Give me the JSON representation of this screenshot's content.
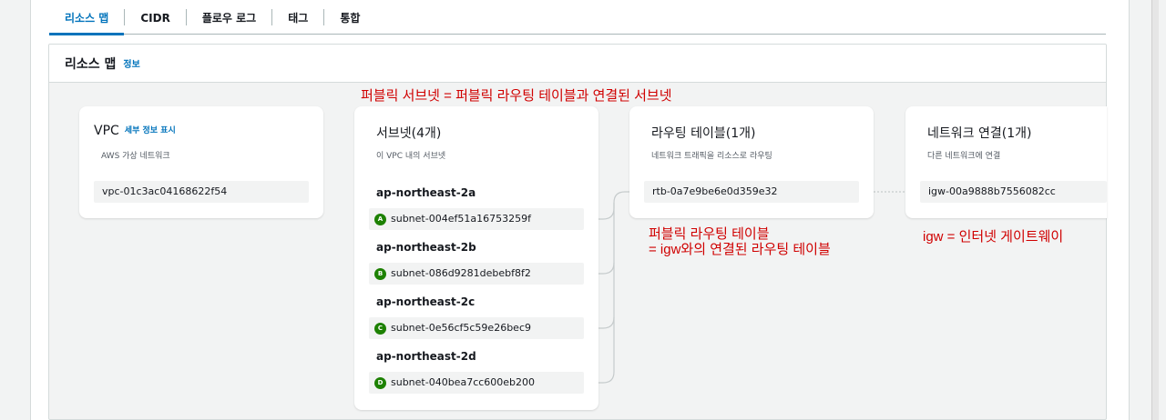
{
  "tabs": [
    {
      "label": "리소스 맵",
      "active": true
    },
    {
      "label": "CIDR",
      "active": false
    },
    {
      "label": "플로우 로그",
      "active": false
    },
    {
      "label": "태그",
      "active": false
    },
    {
      "label": "통합",
      "active": false
    }
  ],
  "panel": {
    "title": "리소스 맵",
    "info_link": "정보"
  },
  "vpc": {
    "title": "VPC",
    "detail_link": "세부 정보 표시",
    "description": "AWS 가상 네트워크",
    "id": "vpc-01c3ac04168622f54"
  },
  "subnets": {
    "title": "서브넷(4개)",
    "description": "이 VPC 내의 서브넷",
    "groups": [
      {
        "az": "ap-northeast-2a",
        "badge": "A",
        "id": "subnet-004ef51a16753259f"
      },
      {
        "az": "ap-northeast-2b",
        "badge": "B",
        "id": "subnet-086d9281debebf8f2"
      },
      {
        "az": "ap-northeast-2c",
        "badge": "C",
        "id": "subnet-0e56cf5c59e26bec9"
      },
      {
        "az": "ap-northeast-2d",
        "badge": "D",
        "id": "subnet-040bea7cc600eb200"
      }
    ]
  },
  "route_tables": {
    "title": "라우팅 테이블(1개)",
    "description": "네트워크 트래픽을 리소스로 라우팅",
    "id": "rtb-0a7e9be6e0d359e32"
  },
  "network_connections": {
    "title": "네트워크 연결(1개)",
    "description": "다른 네트워크에 연결",
    "id": "igw-00a9888b7556082cc"
  },
  "annotations": {
    "public_subnet": "퍼블릭 서브넷 = 퍼블릭 라우팅 테이블과 연결된 서브넷",
    "public_rtb_line1": "퍼블릭 라우팅 테이블",
    "public_rtb_line2": "= igw와의 연결된 라우팅 테이블",
    "igw": "igw = 인터넷 게이트웨이"
  },
  "colors": {
    "accent": "#0073bb",
    "badge": "#1d8102",
    "annotation": "#d00000",
    "connector": "#c6cbcc"
  }
}
